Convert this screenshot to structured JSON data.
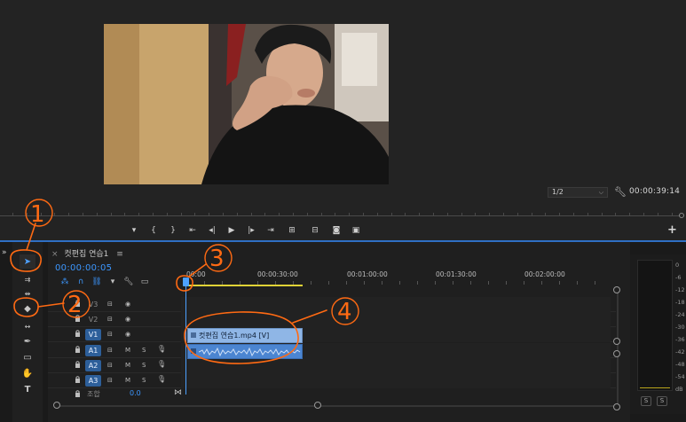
{
  "program_monitor": {
    "zoom_level": "1/2",
    "duration_timecode": "00:00:39:14"
  },
  "timeline": {
    "sequence_tab": "컷편집 연습1",
    "playhead_timecode": "00:00:00:05",
    "ruler_labels": [
      "00:00",
      "00:00:30:00",
      "00:01:00:00",
      "00:01:30:00",
      "00:02:00:00"
    ],
    "video_tracks": [
      "V3",
      "V2",
      "V1"
    ],
    "audio_tracks": [
      "A1",
      "A2",
      "A3"
    ],
    "mute_label": "M",
    "solo_label": "S",
    "master_label": "조합",
    "master_value": "0.0",
    "video_clip_label": "컷편집 연습1.mp4 [V]"
  },
  "audio_meter": {
    "db_labels": [
      "0",
      "-6",
      "-12",
      "-18",
      "-24",
      "-30",
      "-36",
      "-42",
      "-48",
      "-54",
      "dB"
    ],
    "solo_buttons": [
      "S",
      "S"
    ]
  },
  "annotations": {
    "marks": [
      "1",
      "2",
      "3",
      "4"
    ],
    "color": "#ff6a13"
  },
  "colors": {
    "accent_blue": "#3c97ff",
    "work_area_yellow": "#e0d236",
    "video_clip": "#8fb6e6",
    "audio_clip": "#4b85d1"
  }
}
